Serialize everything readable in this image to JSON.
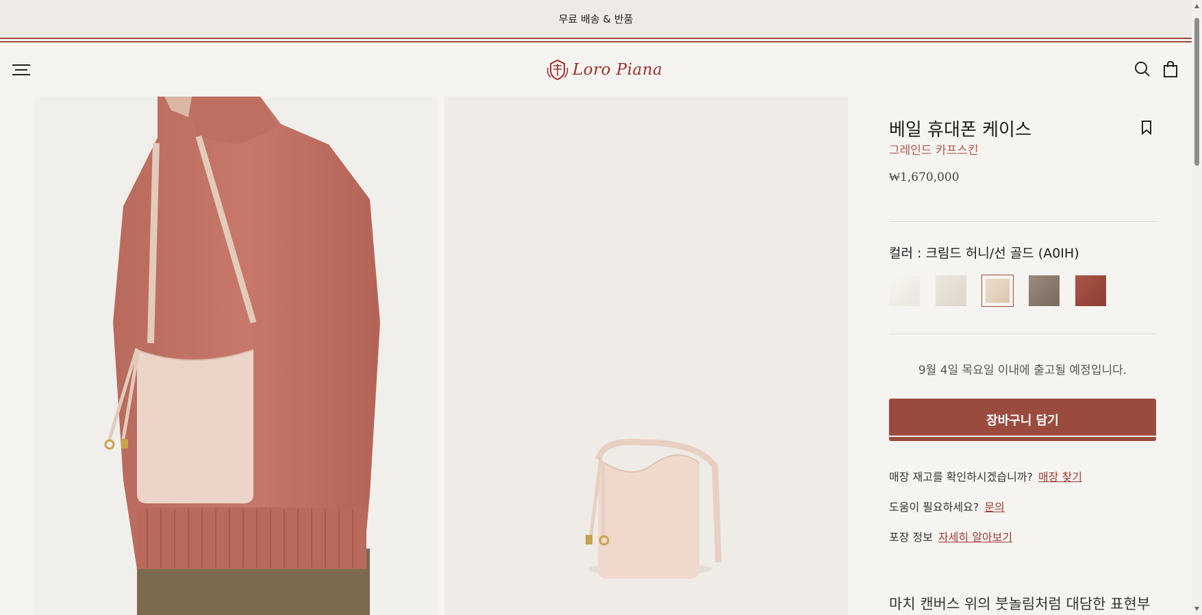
{
  "promo": {
    "text": "무료 배송 & 반품"
  },
  "header": {
    "brand": "Loro Piana",
    "menu_icon": "hamburger-menu-icon",
    "search_icon": "search-icon",
    "bag_icon": "shopping-bag-icon"
  },
  "gallery": {
    "images": [
      "model-wearing-bag",
      "bag-product-shot"
    ]
  },
  "product": {
    "title": "베일 휴대폰 케이스",
    "material": "그레인드 카프스킨",
    "price": "₩1,670,000",
    "bookmark_icon": "bookmark-icon",
    "color_label": "컬러 : 크림드 허니/선 골드 (A0IH)",
    "swatches": [
      {
        "color": "#f2efe9",
        "selected": false
      },
      {
        "color": "#e6e0d6",
        "selected": false
      },
      {
        "color": "#e4d3bf",
        "selected": true
      },
      {
        "color": "#8b7a6e",
        "selected": false
      },
      {
        "color": "#9a4a3d",
        "selected": false
      }
    ],
    "shipping": "9월 4일 목요일 이내에 출고될 예정입니다.",
    "add_to_cart": "장바구니 담기",
    "stock_question": "매장 재고를 확인하시겠습니까?",
    "stock_link": "매장 찾기",
    "help_question": "도움이 필요하세요?",
    "help_link": "문의",
    "packaging_label": "포장 정보",
    "packaging_link": "자세히 알아보기",
    "description": "마치 캔버스 위의 붓놀림처럼 대담한 표현부터"
  },
  "colors": {
    "accent": "#9b4b3e",
    "material_text": "#b2574a",
    "background": "#f6f4f0"
  }
}
